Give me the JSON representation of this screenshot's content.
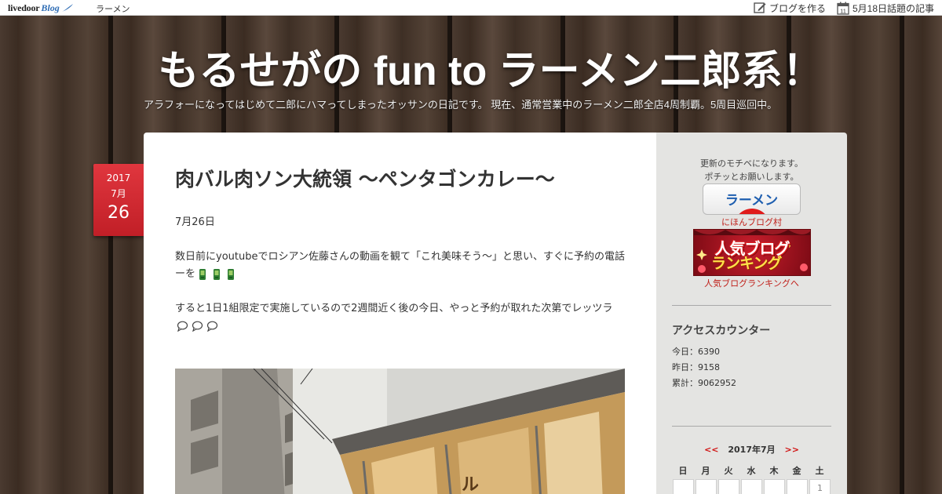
{
  "topbar": {
    "logo_text": "livedoor",
    "logo_blog": "Blog",
    "category": "ラーメン",
    "make_blog": "ブログを作る",
    "calendar_day": "11",
    "trending": "5月18日話題の記事"
  },
  "header": {
    "title": "もるせがの fun to ラーメン二郎系！",
    "description": "アラフォーになってはじめて二郎にハマってしまったオッサンの日記です。 現在、通常営業中のラーメン二郎全店4周制覇。5周目巡回中。"
  },
  "post": {
    "date": {
      "year": "2017",
      "month": "7月",
      "day": "26"
    },
    "title": "肉バル肉ソン大統領 〜ペンタゴンカレー〜",
    "paragraphs": [
      "7月26日",
      "数日前にyoutubeでロシアン佐藤さんの動画を観て「これ美味そう〜」と思い、すぐに予約の電話ーを",
      "すると1日1組限定で実施しているので2週間近く後の今日、やっと予約が取れた次第でレッツラ"
    ],
    "photo_sign": "ル",
    "colors": {
      "accent": "#c8232b"
    }
  },
  "sidebar": {
    "motive_line1": "更新のモチベになります。",
    "motive_line2": "ポチッとお願いします。",
    "ramen_button": "ラーメン",
    "nihon_link": "にほんブログ村",
    "banner_line1": "人気ブログ",
    "banner_line2": "ランキング",
    "ranking_link": "人気ブログランキングへ",
    "counter": {
      "title": "アクセスカウンター",
      "today": "今日：6390",
      "yesterday": "昨日：9158",
      "total": "累計：9062952"
    },
    "calendar": {
      "prev": "<<",
      "month": "2017年7月",
      "next": ">>",
      "weekdays": [
        "日",
        "月",
        "火",
        "水",
        "木",
        "金",
        "土"
      ],
      "first_week": [
        "",
        "",
        "",
        "",
        "",
        "",
        "1"
      ]
    }
  }
}
